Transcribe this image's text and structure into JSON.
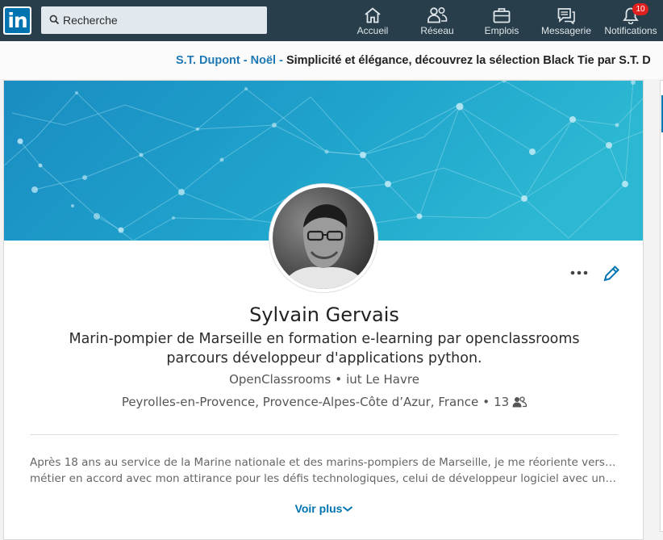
{
  "nav": {
    "logo_text": "in",
    "search": {
      "placeholder": "Recherche",
      "value": ""
    },
    "items": [
      {
        "label": "Accueil",
        "icon": "home-icon"
      },
      {
        "label": "Réseau",
        "icon": "network-icon"
      },
      {
        "label": "Emplois",
        "icon": "briefcase-icon"
      },
      {
        "label": "Messagerie",
        "icon": "messaging-icon"
      },
      {
        "label": "Notifications",
        "icon": "bell-icon",
        "badge": "10"
      }
    ]
  },
  "ad": {
    "brand": "S.T. Dupont - Noël - ",
    "message": "Simplicité et élégance, découvrez la sélection Black Tie par S.T. D"
  },
  "profile": {
    "name": "Sylvain Gervais",
    "headline": "Marin-pompier de Marseille en formation e-learning par openclassrooms parcours développeur d'applications python.",
    "company": "OpenClassrooms",
    "school": "iut Le Havre",
    "location": "Peyrolles-en-Provence, Provence-Alpes-Côte d’Azur, France",
    "connections": "13",
    "summary_line1": "Après 18 ans au service de la Marine nationale et des marins-pompiers de Marseille, je me réoriente vers un nouveau",
    "summary_line2": "métier en accord avec mon attirance pour les défis technologiques, celui de développeur logiciel avec une préférence",
    "see_more": "Voir plus"
  },
  "colors": {
    "nav_bg": "#283e4a",
    "brand_blue": "#0073b1",
    "badge_red": "#e0201f",
    "cover_start": "#1a8fc4",
    "cover_end": "#28b6cf"
  }
}
